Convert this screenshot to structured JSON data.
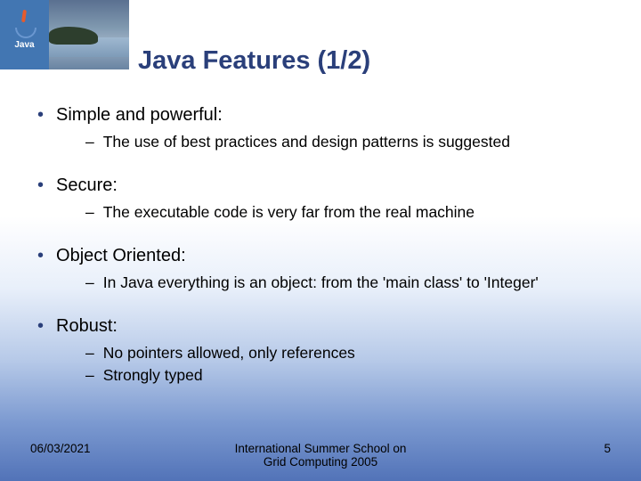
{
  "title": "Java Features (1/2)",
  "bullets": [
    {
      "heading": "Simple and powerful:",
      "subs": [
        "The use of best practices and design patterns is suggested"
      ]
    },
    {
      "heading": "Secure:",
      "subs": [
        "The executable code is very far from the real machine"
      ]
    },
    {
      "heading": "Object Oriented:",
      "subs": [
        "In Java everything is an object: from the 'main class' to 'Integer'"
      ]
    },
    {
      "heading": "Robust:",
      "subs": [
        "No pointers allowed, only references",
        "Strongly typed"
      ]
    }
  ],
  "footer": {
    "date": "06/03/2021",
    "center_line1": "International Summer School on",
    "center_line2": "Grid Computing 2005",
    "page": "5"
  },
  "logo": {
    "text": "Java"
  }
}
